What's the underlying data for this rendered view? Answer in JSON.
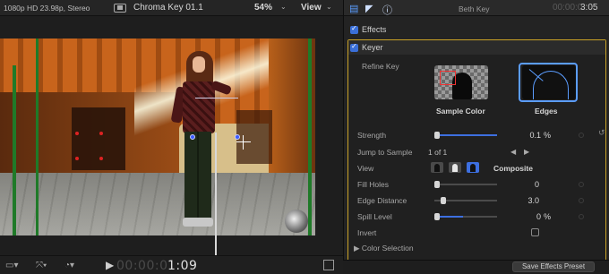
{
  "viewer": {
    "format": "1080p HD 23.98p, Stereo",
    "clip_name": "Chroma Key 01.1",
    "zoom": "54%",
    "view_label": "View",
    "timecode_dim": "00:00:0",
    "timecode": "1:09"
  },
  "inspector": {
    "title": "Beth Key",
    "timecode_dim": "00:00:0",
    "timecode": "3:05",
    "effects_label": "Effects",
    "keyer_label": "Keyer",
    "refine_key_label": "Refine Key",
    "sample_color_label": "Sample Color",
    "edges_label": "Edges",
    "params": [
      {
        "label": "Strength",
        "value": "0.1",
        "unit": "%",
        "level": 0.02
      },
      {
        "label": "Jump to Sample",
        "value": "1 of 1"
      },
      {
        "label": "View",
        "value": "Composite"
      },
      {
        "label": "Fill Holes",
        "value": "0",
        "level": 0.0
      },
      {
        "label": "Edge Distance",
        "value": "3.0",
        "level": 0.1
      },
      {
        "label": "Spill Level",
        "value": "0",
        "unit": "%",
        "level": 0.0
      },
      {
        "label": "Invert"
      }
    ],
    "color_selection_label": "Color Selection",
    "save_preset_label": "Save Effects Preset"
  },
  "colors": {
    "accent": "#3d6fe0",
    "highlight": "#c9a227"
  }
}
